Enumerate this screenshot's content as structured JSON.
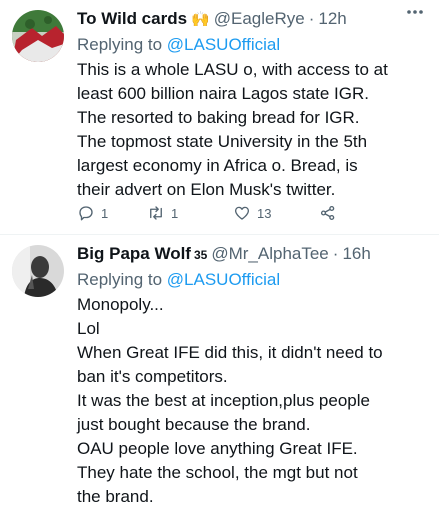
{
  "tweets": [
    {
      "name": "To Wild cards",
      "emoji": "🙌",
      "badge": "",
      "handle": "@EagleRye",
      "separator": "·",
      "time": "12h",
      "replying_prefix": "Replying to",
      "replying_to": "@LASUOfficial",
      "lines": [
        "This is a whole LASU o, with access to at",
        "least 600 billion naira Lagos state IGR.",
        "The resorted to baking bread for IGR.",
        "The topmost state University in the 5th",
        "largest economy in Africa o. Bread, is",
        "their advert on Elon Musk's twitter."
      ],
      "reply_count": "1",
      "retweet_count": "1",
      "like_count": "13"
    },
    {
      "name": "Big Papa Wolf",
      "emoji": "",
      "badge": "35",
      "handle": "@Mr_AlphaTee",
      "separator": "·",
      "time": "16h",
      "replying_prefix": "Replying to",
      "replying_to": "@LASUOfficial",
      "lines": [
        "Monopoly...",
        "Lol",
        "When Great IFE did this, it didn't need to",
        "ban it's competitors.",
        "It was the best at inception,plus people",
        "just bought because the brand.",
        "OAU people love anything Great IFE.",
        "They hate the school, the mgt but not",
        "the brand."
      ]
    }
  ],
  "icons": {
    "more": "more-dots-icon",
    "reply": "reply-bubble-icon",
    "retweet": "retweet-icon",
    "like": "heart-icon",
    "share": "share-icon"
  },
  "colors": {
    "link": "#1d9bf0",
    "secondary": "#536471",
    "text": "#0f1419"
  }
}
